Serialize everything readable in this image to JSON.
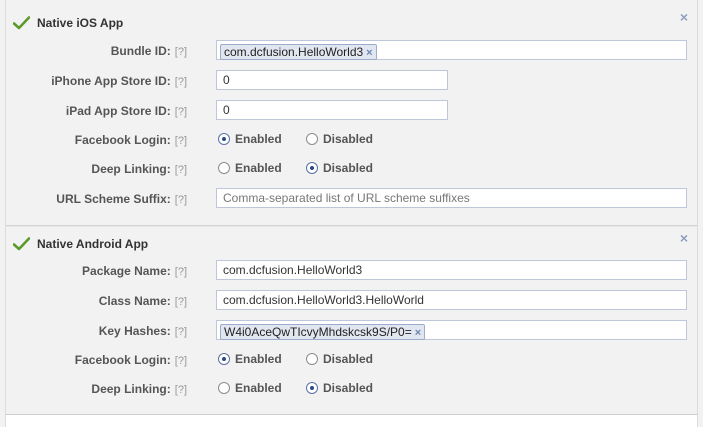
{
  "ios": {
    "title": "Native iOS App",
    "bundle_id": {
      "label": "Bundle ID:",
      "help": "[?]",
      "token": "com.dcfusion.HelloWorld3",
      "token_remove": "×"
    },
    "iphone_store_id": {
      "label": "iPhone App Store ID:",
      "help": "[?]",
      "value": "0"
    },
    "ipad_store_id": {
      "label": "iPad App Store ID:",
      "help": "[?]",
      "value": "0"
    },
    "facebook_login": {
      "label": "Facebook Login:",
      "help": "[?]",
      "opt1": "Enabled",
      "opt2": "Disabled",
      "selected": "Enabled"
    },
    "deep_linking": {
      "label": "Deep Linking:",
      "help": "[?]",
      "opt1": "Enabled",
      "opt2": "Disabled",
      "selected": "Disabled"
    },
    "url_scheme": {
      "label": "URL Scheme Suffix:",
      "help": "[?]",
      "placeholder": "Comma-separated list of URL scheme suffixes"
    },
    "close": "×"
  },
  "android": {
    "title": "Native Android App",
    "package_name": {
      "label": "Package Name:",
      "help": "[?]",
      "value": "com.dcfusion.HelloWorld3"
    },
    "class_name": {
      "label": "Class Name:",
      "help": "[?]",
      "value": "com.dcfusion.HelloWorld3.HelloWorld"
    },
    "key_hashes": {
      "label": "Key Hashes:",
      "help": "[?]",
      "token": "W4i0AceQwTIcvyMhdskcsk9S/P0=",
      "token_remove": "×"
    },
    "facebook_login": {
      "label": "Facebook Login:",
      "help": "[?]",
      "opt1": "Enabled",
      "opt2": "Disabled",
      "selected": "Enabled"
    },
    "deep_linking": {
      "label": "Deep Linking:",
      "help": "[?]",
      "opt1": "Enabled",
      "opt2": "Disabled",
      "selected": "Disabled"
    },
    "close": "×"
  },
  "colors": {
    "check": "#5a9b2c",
    "accent": "#3b5998",
    "close": "#8f9fbf"
  },
  "icons": {
    "enabled_check": "check-icon",
    "close": "close-icon"
  }
}
